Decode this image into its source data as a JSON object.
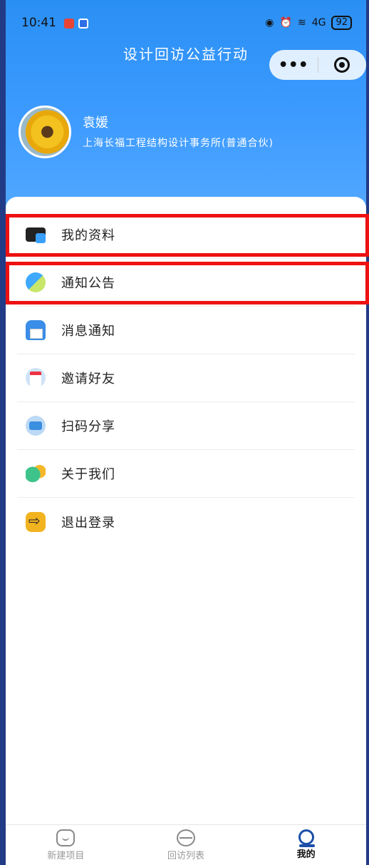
{
  "status_bar": {
    "time": "10:41",
    "battery": "92",
    "network": "4G"
  },
  "app": {
    "title": "设计回访公益行动",
    "capsule_more": "•••"
  },
  "profile": {
    "name": "袁媛",
    "organization": "上海长福工程结构设计事务所(普通合伙)"
  },
  "menu": {
    "items": [
      {
        "label": "我的资料",
        "icon": "profile-card-icon"
      },
      {
        "label": "通知公告",
        "icon": "announcement-icon"
      },
      {
        "label": "消息通知",
        "icon": "message-icon"
      },
      {
        "label": "邀请好友",
        "icon": "invite-icon"
      },
      {
        "label": "扫码分享",
        "icon": "share-icon"
      },
      {
        "label": "关于我们",
        "icon": "about-icon"
      },
      {
        "label": "退出登录",
        "icon": "logout-icon"
      }
    ]
  },
  "tabbar": {
    "tabs": [
      {
        "label": "新建项目",
        "icon": "new-project-icon"
      },
      {
        "label": "回访列表",
        "icon": "visit-list-icon"
      },
      {
        "label": "我的",
        "icon": "mine-icon"
      }
    ],
    "active_index": 2
  },
  "colors": {
    "header_gradient_top": "#2a8ff3",
    "header_gradient_bottom": "#52a8ff",
    "highlight": "#ee1111",
    "active_tab": "#1b4fa8"
  }
}
